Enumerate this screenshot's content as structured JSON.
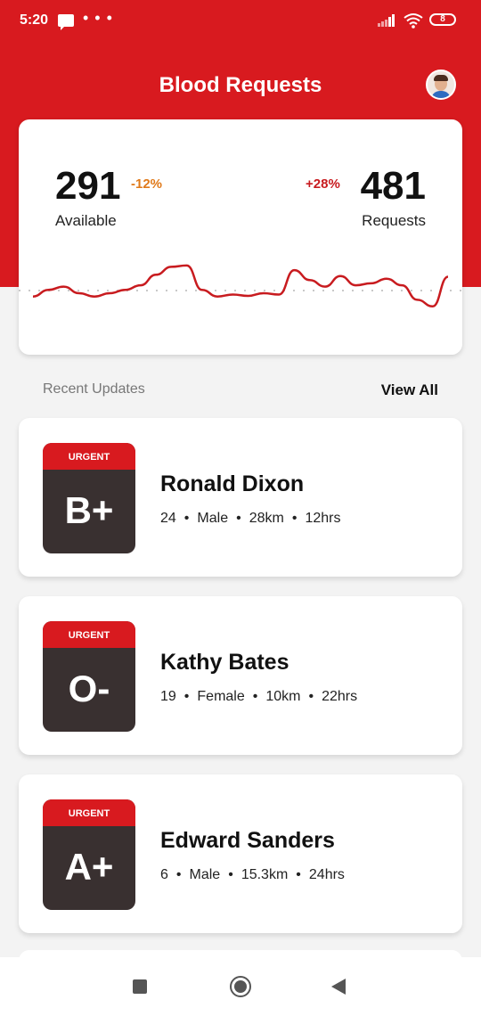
{
  "status_bar": {
    "time": "5:20",
    "dots": "• • •",
    "battery": "8"
  },
  "header": {
    "title": "Blood Requests"
  },
  "stats": {
    "available": {
      "value": "291",
      "change": "-12%",
      "label": "Available"
    },
    "requests": {
      "value": "481",
      "change": "+28%",
      "label": "Requests"
    }
  },
  "chart_data": {
    "type": "line",
    "series": [
      {
        "values": [
          0.45,
          0.55,
          0.6,
          0.5,
          0.45,
          0.5,
          0.55,
          0.62,
          0.78,
          0.9,
          0.92,
          0.55,
          0.45,
          0.48,
          0.46,
          0.5,
          0.48,
          0.85,
          0.7,
          0.6,
          0.76,
          0.62,
          0.65,
          0.72,
          0.62,
          0.4,
          0.3,
          0.75
        ]
      }
    ],
    "colors": {
      "line": "#c81b1f",
      "baseline": "#c9c9c9"
    }
  },
  "recent": {
    "label": "Recent Updates",
    "view_all": "View All"
  },
  "requests": [
    {
      "badge": "URGENT",
      "blood_type": "B+",
      "name": "Ronald Dixon",
      "age": "24",
      "gender": "Male",
      "distance": "28km",
      "time": "12hrs"
    },
    {
      "badge": "URGENT",
      "blood_type": "O-",
      "name": "Kathy Bates",
      "age": "19",
      "gender": "Female",
      "distance": "10km",
      "time": "22hrs"
    },
    {
      "badge": "URGENT",
      "blood_type": "A+",
      "name": "Edward Sanders",
      "age": "6",
      "gender": "Male",
      "distance": "15.3km",
      "time": "24hrs"
    }
  ],
  "colors": {
    "brand": "#d81a1f",
    "badge_dark": "#393030",
    "decrease": "#e07a1a",
    "increase": "#c81b1f"
  }
}
